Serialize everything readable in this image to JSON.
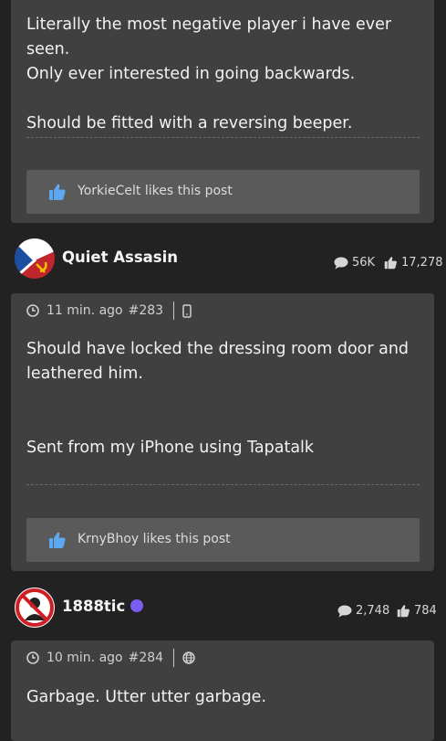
{
  "posts": [
    {
      "body_lines": [
        "Literally the most negative player i have ever seen.",
        "Only ever interested in going backwards.",
        "",
        "Should be fitted with a reversing beeper."
      ],
      "likes_text": "YorkieCelt likes this post"
    },
    {
      "author": "Quiet Assasin",
      "author_posts": "56K",
      "author_likes": "17,278",
      "time": "11 min. ago",
      "post_number": "#283",
      "body_lines": [
        "Should have locked the dressing room door and",
        "leathered him.",
        "",
        "",
        "Sent from my iPhone using Tapatalk"
      ],
      "likes_text": "KrnyBhoy likes this post"
    },
    {
      "author": "1888tic",
      "author_posts": "2,748",
      "author_likes": "784",
      "time": "10 min. ago",
      "post_number": "#284",
      "body_lines": [
        "Garbage. Utter utter garbage."
      ]
    }
  ],
  "colors": {
    "background": "#222222",
    "card": "#404040",
    "likes_bar": "#5a5a5a",
    "online": "#7b5cf0"
  },
  "icons": {
    "like": "thumbs-up-icon",
    "posts": "speech-bubble-icon",
    "time": "clock-icon",
    "device_mobile": "mobile-device-icon",
    "device_web": "globe-icon"
  }
}
